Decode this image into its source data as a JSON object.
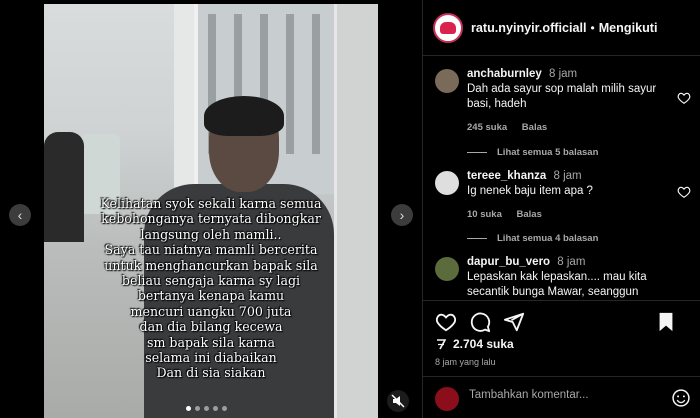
{
  "post": {
    "overlay_caption": "Kelihatan syok sekali karna semua\nkebohonganya ternyata dibongkar\nlangsung oleh mamli..\nSaya tau niatnya mamli bercerita\nuntuk menghancurkan bapak sila\nbeliau sengaja karna sy lagi\nbertanya kenapa kamu\nmencuri uangku 700 juta\ndan dia bilang kecewa\nsm bapak sila karna\nselama ini diabaikan\nDan di sia siakan",
    "carousel_dots": 5,
    "active_dot": 0
  },
  "header": {
    "username": "ratu.nyinyir.officiall",
    "separator": "•",
    "follow_label": "Mengikuti"
  },
  "comments": [
    {
      "username": "anchaburnley",
      "time": "8 jam",
      "text": "Dah ada sayur sop malah milih sayur basi, hadeh",
      "likes": "245 suka",
      "reply_label": "Balas",
      "view_replies": "Lihat semua 5 balasan",
      "avatar_color": "#7a6a5a"
    },
    {
      "username": "tereee_khanza",
      "time": "8 jam",
      "text": "Ig nenek baju item apa ?",
      "likes": "10 suka",
      "reply_label": "Balas",
      "view_replies": "Lihat semua 4 balasan",
      "avatar_color": "#dedede"
    },
    {
      "username": "dapur_bu_vero",
      "time": "8 jam",
      "text": "Lepaskan kak lepaskan.... mau kita secantik bunga Mawar, seanggun",
      "avatar_color": "#5c6b3c"
    }
  ],
  "actions": {
    "likes_prefix": "",
    "likes_count": "2.704 suka",
    "post_time": "8 jam yang lalu",
    "comment_placeholder": "Tambahkan komentar..."
  },
  "colors": {
    "background": "#000000",
    "text": "#f5f5f5",
    "muted": "#a8a8a8",
    "divider": "#262626"
  }
}
